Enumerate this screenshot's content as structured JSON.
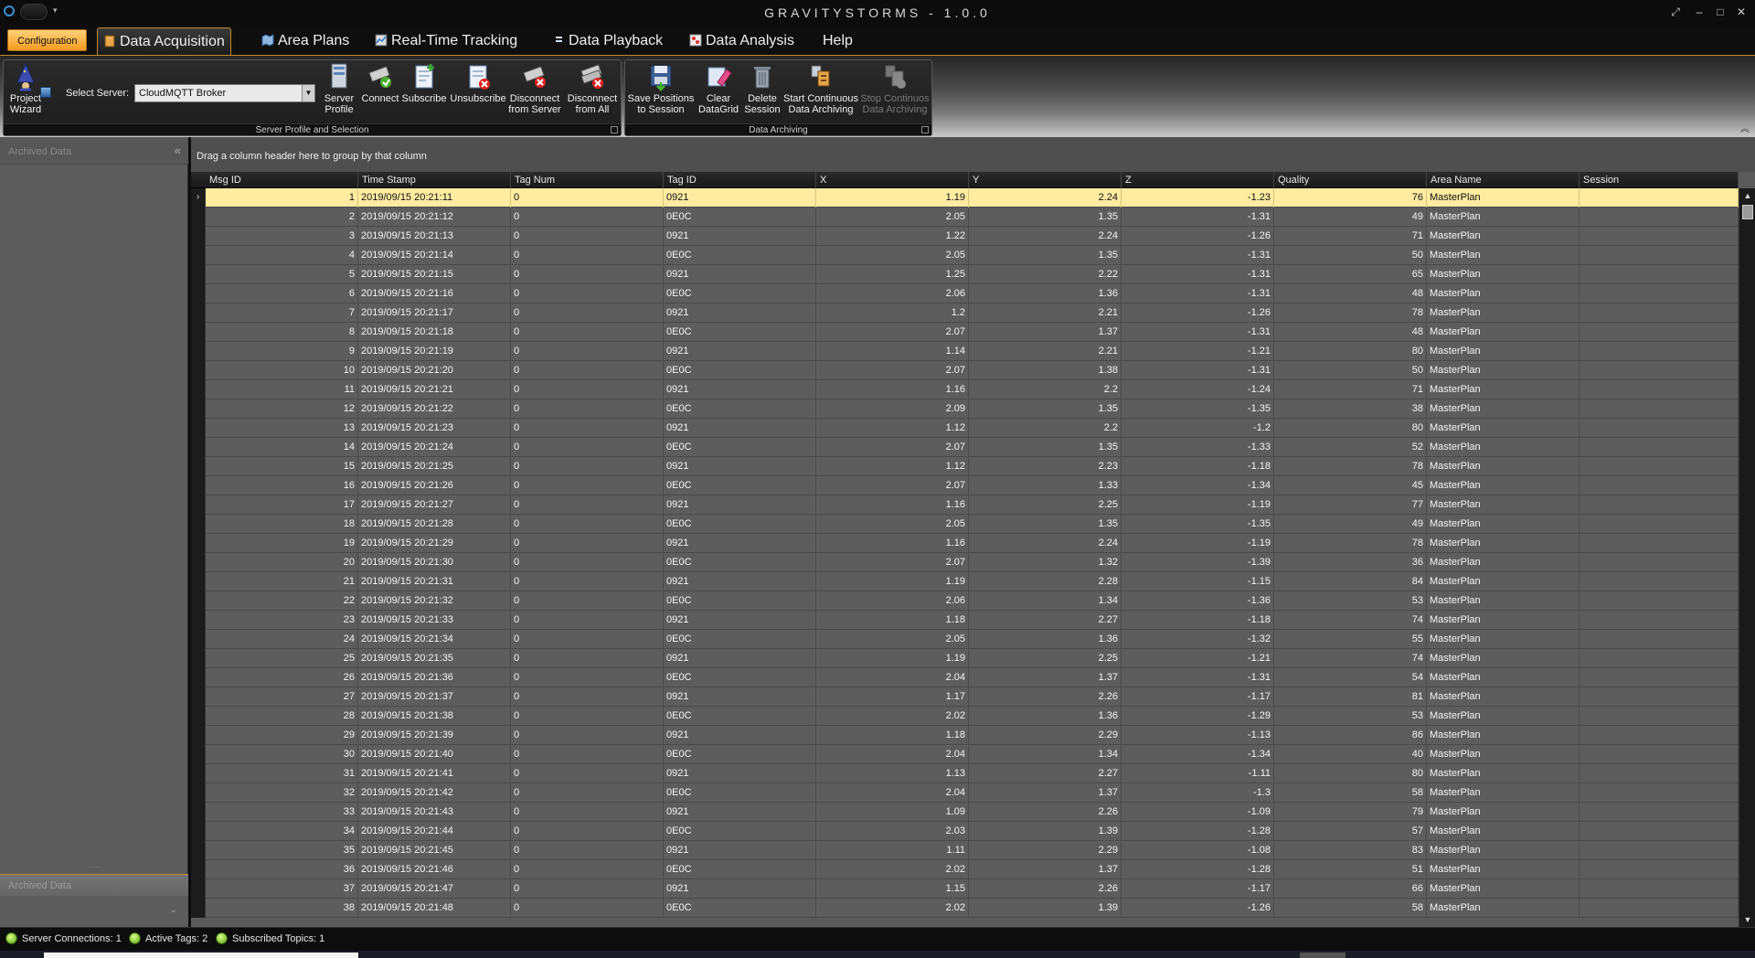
{
  "app_title": "GRAVITYSTORMS - 1.0.0",
  "window_controls": {
    "restore": "⤢",
    "minimize": "–",
    "maximize": "□",
    "close": "✕"
  },
  "tabs": {
    "configuration": "Configuration",
    "data_acquisition": "Data Acquisition",
    "area_plans": "Area Plans",
    "real_time_tracking": "Real-Time Tracking",
    "data_playback": "Data Playback",
    "data_analysis": "Data Analysis",
    "help": "Help"
  },
  "ribbon": {
    "server_group": {
      "caption": "Server Profile and Selection",
      "project_wizard": [
        "Project",
        "Wizard"
      ],
      "select_server_label": "Select Server:",
      "select_server_value": "CloudMQTT Broker",
      "server_profile": [
        "Server",
        "Profile"
      ],
      "connect": "Connect",
      "subscribe": "Subscribe",
      "unsubscribe": "Unsubscribe",
      "disconnect_server": [
        "Disconnect",
        "from Server"
      ],
      "disconnect_all": [
        "Disconnect",
        "from All"
      ]
    },
    "archive_group": {
      "caption": "Data Archiving",
      "save_positions": [
        "Save Positions",
        "to Session"
      ],
      "clear_datagrid": [
        "Clear",
        "DataGrid"
      ],
      "delete_session": [
        "Delete",
        "Session"
      ],
      "start_archiving": [
        "Start Continuous",
        "Data Archiving"
      ],
      "stop_archiving": [
        "Stop Continuos",
        "Data Archiving"
      ]
    }
  },
  "left_panel": {
    "header": "Archived Data",
    "footer": "Archived Data"
  },
  "grid": {
    "group_hint": "Drag a column header here to group by that column",
    "columns": [
      "Msg ID",
      "Time Stamp",
      "Tag Num",
      "Tag ID",
      "X",
      "Y",
      "Z",
      "Quality",
      "Area Name",
      "Session"
    ],
    "rows": [
      [
        "1",
        "2019/09/15 20:21:11",
        "0",
        "0921",
        "1.19",
        "2.24",
        "-1.23",
        "76",
        "MasterPlan",
        ""
      ],
      [
        "2",
        "2019/09/15 20:21:12",
        "0",
        "0E0C",
        "2.05",
        "1.35",
        "-1.31",
        "49",
        "MasterPlan",
        ""
      ],
      [
        "3",
        "2019/09/15 20:21:13",
        "0",
        "0921",
        "1.22",
        "2.24",
        "-1.26",
        "71",
        "MasterPlan",
        ""
      ],
      [
        "4",
        "2019/09/15 20:21:14",
        "0",
        "0E0C",
        "2.05",
        "1.35",
        "-1.31",
        "50",
        "MasterPlan",
        ""
      ],
      [
        "5",
        "2019/09/15 20:21:15",
        "0",
        "0921",
        "1.25",
        "2.22",
        "-1.31",
        "65",
        "MasterPlan",
        ""
      ],
      [
        "6",
        "2019/09/15 20:21:16",
        "0",
        "0E0C",
        "2.06",
        "1.36",
        "-1.31",
        "48",
        "MasterPlan",
        ""
      ],
      [
        "7",
        "2019/09/15 20:21:17",
        "0",
        "0921",
        "1.2",
        "2.21",
        "-1.26",
        "78",
        "MasterPlan",
        ""
      ],
      [
        "8",
        "2019/09/15 20:21:18",
        "0",
        "0E0C",
        "2.07",
        "1.37",
        "-1.31",
        "48",
        "MasterPlan",
        ""
      ],
      [
        "9",
        "2019/09/15 20:21:19",
        "0",
        "0921",
        "1.14",
        "2.21",
        "-1.21",
        "80",
        "MasterPlan",
        ""
      ],
      [
        "10",
        "2019/09/15 20:21:20",
        "0",
        "0E0C",
        "2.07",
        "1.38",
        "-1.31",
        "50",
        "MasterPlan",
        ""
      ],
      [
        "11",
        "2019/09/15 20:21:21",
        "0",
        "0921",
        "1.16",
        "2.2",
        "-1.24",
        "71",
        "MasterPlan",
        ""
      ],
      [
        "12",
        "2019/09/15 20:21:22",
        "0",
        "0E0C",
        "2.09",
        "1.35",
        "-1.35",
        "38",
        "MasterPlan",
        ""
      ],
      [
        "13",
        "2019/09/15 20:21:23",
        "0",
        "0921",
        "1.12",
        "2.2",
        "-1.2",
        "80",
        "MasterPlan",
        ""
      ],
      [
        "14",
        "2019/09/15 20:21:24",
        "0",
        "0E0C",
        "2.07",
        "1.35",
        "-1.33",
        "52",
        "MasterPlan",
        ""
      ],
      [
        "15",
        "2019/09/15 20:21:25",
        "0",
        "0921",
        "1.12",
        "2.23",
        "-1.18",
        "78",
        "MasterPlan",
        ""
      ],
      [
        "16",
        "2019/09/15 20:21:26",
        "0",
        "0E0C",
        "2.07",
        "1.33",
        "-1.34",
        "45",
        "MasterPlan",
        ""
      ],
      [
        "17",
        "2019/09/15 20:21:27",
        "0",
        "0921",
        "1.16",
        "2.25",
        "-1.19",
        "77",
        "MasterPlan",
        ""
      ],
      [
        "18",
        "2019/09/15 20:21:28",
        "0",
        "0E0C",
        "2.05",
        "1.35",
        "-1.35",
        "49",
        "MasterPlan",
        ""
      ],
      [
        "19",
        "2019/09/15 20:21:29",
        "0",
        "0921",
        "1.16",
        "2.24",
        "-1.19",
        "78",
        "MasterPlan",
        ""
      ],
      [
        "20",
        "2019/09/15 20:21:30",
        "0",
        "0E0C",
        "2.07",
        "1.32",
        "-1.39",
        "36",
        "MasterPlan",
        ""
      ],
      [
        "21",
        "2019/09/15 20:21:31",
        "0",
        "0921",
        "1.19",
        "2.28",
        "-1.15",
        "84",
        "MasterPlan",
        ""
      ],
      [
        "22",
        "2019/09/15 20:21:32",
        "0",
        "0E0C",
        "2.06",
        "1.34",
        "-1.36",
        "53",
        "MasterPlan",
        ""
      ],
      [
        "23",
        "2019/09/15 20:21:33",
        "0",
        "0921",
        "1.18",
        "2.27",
        "-1.18",
        "74",
        "MasterPlan",
        ""
      ],
      [
        "24",
        "2019/09/15 20:21:34",
        "0",
        "0E0C",
        "2.05",
        "1.36",
        "-1.32",
        "55",
        "MasterPlan",
        ""
      ],
      [
        "25",
        "2019/09/15 20:21:35",
        "0",
        "0921",
        "1.19",
        "2.25",
        "-1.21",
        "74",
        "MasterPlan",
        ""
      ],
      [
        "26",
        "2019/09/15 20:21:36",
        "0",
        "0E0C",
        "2.04",
        "1.37",
        "-1.31",
        "54",
        "MasterPlan",
        ""
      ],
      [
        "27",
        "2019/09/15 20:21:37",
        "0",
        "0921",
        "1.17",
        "2.26",
        "-1.17",
        "81",
        "MasterPlan",
        ""
      ],
      [
        "28",
        "2019/09/15 20:21:38",
        "0",
        "0E0C",
        "2.02",
        "1.36",
        "-1.29",
        "53",
        "MasterPlan",
        ""
      ],
      [
        "29",
        "2019/09/15 20:21:39",
        "0",
        "0921",
        "1.18",
        "2.29",
        "-1.13",
        "86",
        "MasterPlan",
        ""
      ],
      [
        "30",
        "2019/09/15 20:21:40",
        "0",
        "0E0C",
        "2.04",
        "1.34",
        "-1.34",
        "40",
        "MasterPlan",
        ""
      ],
      [
        "31",
        "2019/09/15 20:21:41",
        "0",
        "0921",
        "1.13",
        "2.27",
        "-1.11",
        "80",
        "MasterPlan",
        ""
      ],
      [
        "32",
        "2019/09/15 20:21:42",
        "0",
        "0E0C",
        "2.04",
        "1.37",
        "-1.3",
        "58",
        "MasterPlan",
        ""
      ],
      [
        "33",
        "2019/09/15 20:21:43",
        "0",
        "0921",
        "1.09",
        "2.26",
        "-1.09",
        "79",
        "MasterPlan",
        ""
      ],
      [
        "34",
        "2019/09/15 20:21:44",
        "0",
        "0E0C",
        "2.03",
        "1.39",
        "-1.28",
        "57",
        "MasterPlan",
        ""
      ],
      [
        "35",
        "2019/09/15 20:21:45",
        "0",
        "0921",
        "1.11",
        "2.29",
        "-1.08",
        "83",
        "MasterPlan",
        ""
      ],
      [
        "36",
        "2019/09/15 20:21:46",
        "0",
        "0E0C",
        "2.02",
        "1.37",
        "-1.28",
        "51",
        "MasterPlan",
        ""
      ],
      [
        "37",
        "2019/09/15 20:21:47",
        "0",
        "0921",
        "1.15",
        "2.26",
        "-1.17",
        "66",
        "MasterPlan",
        ""
      ],
      [
        "38",
        "2019/09/15 20:21:48",
        "0",
        "0E0C",
        "2.02",
        "1.39",
        "-1.26",
        "58",
        "MasterPlan",
        ""
      ]
    ],
    "selected_row": 0
  },
  "status": {
    "server_connections": "Server Connections: 1",
    "active_tags": "Active Tags: 2",
    "subscribed_topics": "Subscribed Topics: 1"
  },
  "colors": {
    "accent_orange": "#f39a1e",
    "selected_row": "#ffeca0",
    "status_green": "#5aa10e"
  }
}
